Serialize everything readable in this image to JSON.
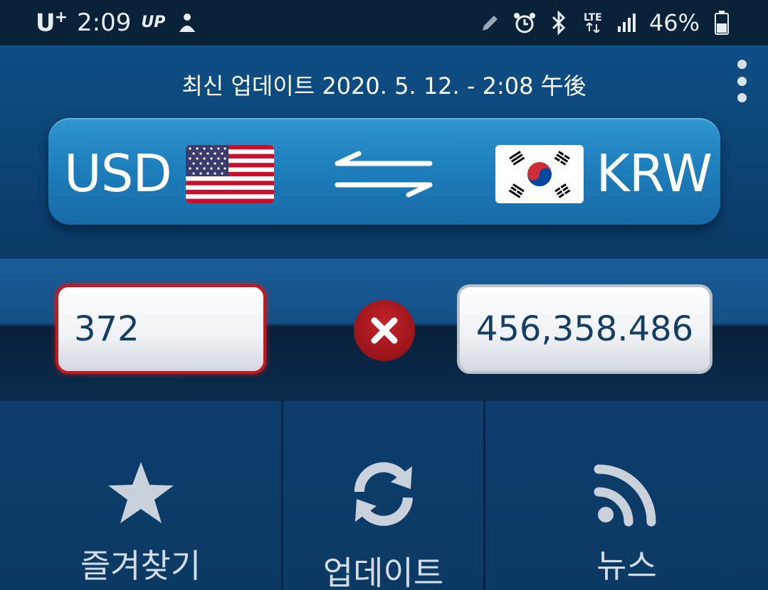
{
  "status_bar": {
    "carrier": "U",
    "carrier_sup": "+",
    "time": "2:09",
    "badge": "UP",
    "network": "LTE",
    "battery": "46%"
  },
  "header": {
    "last_update": "최신 업데이트 2020. 5. 12. - 2:08 午後"
  },
  "converter": {
    "from_currency": "USD",
    "to_currency": "KRW",
    "from_flag": "us-flag",
    "to_flag": "kr-flag",
    "amount": "372",
    "result": "456,358.486"
  },
  "toolbar": {
    "favorites_label": "즐겨찾기",
    "update_label": "업데이트",
    "news_label": "뉴스"
  },
  "colors": {
    "accent_red": "#c6171a",
    "card_blue": "#1f7fbd",
    "background": "#0b2f52"
  }
}
